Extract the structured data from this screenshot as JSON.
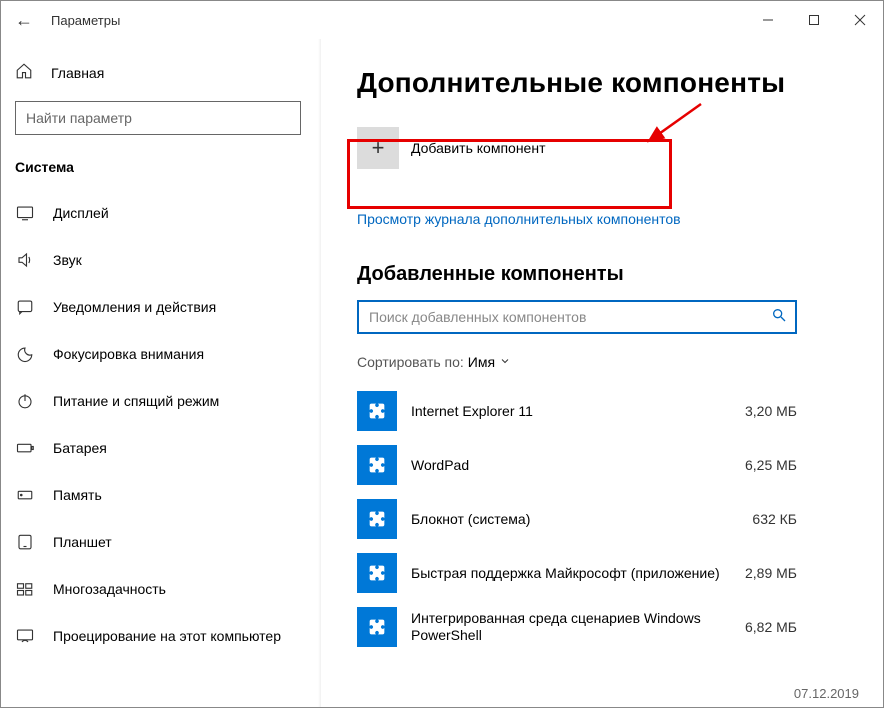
{
  "window": {
    "title": "Параметры"
  },
  "sidebar": {
    "home": "Главная",
    "search_placeholder": "Найти параметр",
    "section": "Система",
    "items": [
      {
        "label": "Дисплей"
      },
      {
        "label": "Звук"
      },
      {
        "label": "Уведомления и действия"
      },
      {
        "label": "Фокусировка внимания"
      },
      {
        "label": "Питание и спящий режим"
      },
      {
        "label": "Батарея"
      },
      {
        "label": "Память"
      },
      {
        "label": "Планшет"
      },
      {
        "label": "Многозадачность"
      },
      {
        "label": "Проецирование на этот компьютер"
      }
    ]
  },
  "main": {
    "heading": "Дополнительные компоненты",
    "add_label": "Добавить компонент",
    "history_link": "Просмотр журнала дополнительных компонентов",
    "installed_heading": "Добавленные компоненты",
    "search_placeholder": "Поиск добавленных компонентов",
    "sort_label": "Сортировать по:",
    "sort_value": "Имя",
    "features": [
      {
        "name": "Internet Explorer 11",
        "size": "3,20 МБ"
      },
      {
        "name": "WordPad",
        "size": "6,25 МБ"
      },
      {
        "name": "Блокнот (система)",
        "size": "632 КБ"
      },
      {
        "name": "Быстрая поддержка Майкрософт (приложение)",
        "size": "2,89 МБ"
      },
      {
        "name": "Интегрированная среда сценариев Windows PowerShell",
        "size": "6,82 МБ"
      }
    ],
    "date": "07.12.2019"
  }
}
